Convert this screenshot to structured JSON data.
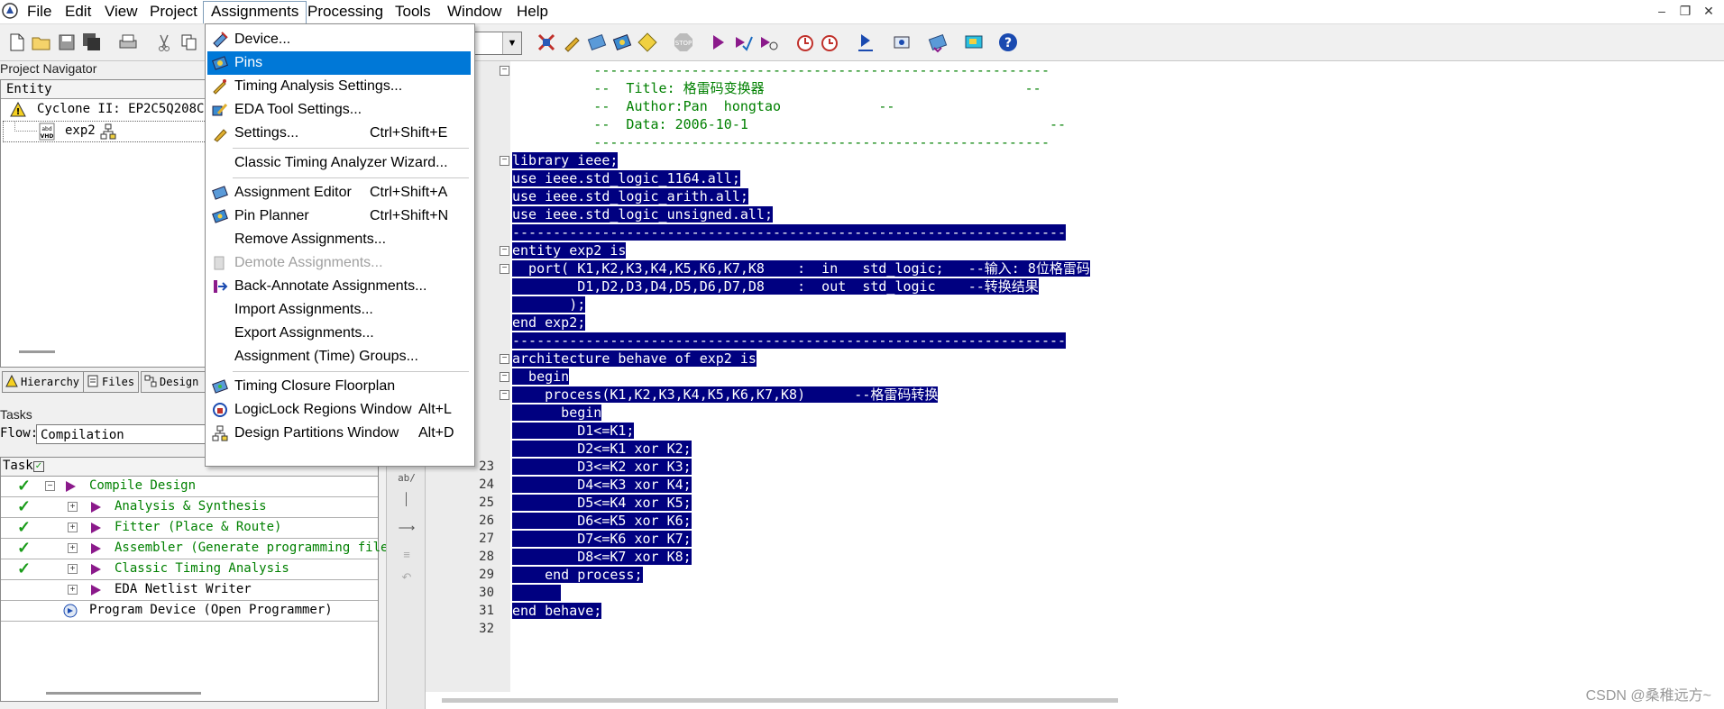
{
  "menubar": {
    "items": [
      "File",
      "Edit",
      "View",
      "Project",
      "Assignments",
      "Processing",
      "Tools",
      "Window",
      "Help"
    ]
  },
  "dropdown": {
    "items": [
      {
        "label": "Device...",
        "shortcut": "",
        "icon": "device-icon"
      },
      {
        "label": "Pins",
        "shortcut": "",
        "icon": "pins-icon"
      },
      {
        "label": "Timing Analysis Settings...",
        "shortcut": "",
        "icon": "timing-settings-icon"
      },
      {
        "label": "EDA Tool Settings...",
        "shortcut": "",
        "icon": "eda-tool-icon"
      },
      {
        "label": "Settings...",
        "shortcut": "Ctrl+Shift+E",
        "icon": "settings-icon"
      },
      {
        "label": "Classic Timing Analyzer Wizard...",
        "shortcut": "",
        "icon": ""
      },
      {
        "label": "Assignment Editor",
        "shortcut": "Ctrl+Shift+A",
        "icon": "assignment-editor-icon"
      },
      {
        "label": "Pin Planner",
        "shortcut": "Ctrl+Shift+N",
        "icon": "pin-planner-icon"
      },
      {
        "label": "Remove Assignments...",
        "shortcut": "",
        "icon": ""
      },
      {
        "label": "Demote Assignments...",
        "shortcut": "",
        "icon": "demote-icon"
      },
      {
        "label": "Back-Annotate Assignments...",
        "shortcut": "",
        "icon": "back-annotate-icon"
      },
      {
        "label": "Import Assignments...",
        "shortcut": "",
        "icon": ""
      },
      {
        "label": "Export Assignments...",
        "shortcut": "",
        "icon": ""
      },
      {
        "label": "Assignment (Time) Groups...",
        "shortcut": "",
        "icon": ""
      },
      {
        "label": "Timing Closure Floorplan",
        "shortcut": "",
        "icon": "floorplan-icon"
      },
      {
        "label": "LogicLock Regions Window",
        "shortcut": "Alt+L",
        "icon": "logiclock-icon"
      },
      {
        "label": "Design Partitions Window",
        "shortcut": "Alt+D",
        "icon": "partitions-icon"
      }
    ]
  },
  "navigator": {
    "title": "Project Navigator",
    "entity_header": "Entity",
    "device": "Cyclone II: EP2C5Q208C8",
    "file": "exp2",
    "tabs": [
      "Hierarchy",
      "Files",
      "Design U"
    ]
  },
  "tasks": {
    "title": "Tasks",
    "flow_label": "Flow:",
    "flow_value": "Compilation",
    "header": "Task",
    "rows": [
      {
        "label": "Compile Design",
        "done": true,
        "green": true
      },
      {
        "label": "Analysis & Synthesis",
        "done": true,
        "green": true
      },
      {
        "label": "Fitter (Place & Route)",
        "done": true,
        "green": true
      },
      {
        "label": "Assembler (Generate programming files)",
        "done": true,
        "green": true
      },
      {
        "label": "Classic Timing Analysis",
        "done": true,
        "green": true
      },
      {
        "label": "EDA Netlist Writer",
        "done": false,
        "green": false
      },
      {
        "label": "Program Device (Open Programmer)",
        "done": false,
        "green": false
      }
    ]
  },
  "editor": {
    "visible_line_numbers": [
      "23",
      "24",
      "25",
      "26",
      "27",
      "28",
      "29",
      "30",
      "31",
      "32"
    ],
    "lines": [
      {
        "text": "          --------------------------------------------------------",
        "sel": false,
        "cmt": true
      },
      {
        "text": "          --  Title: 格雷码变换器                                --",
        "sel": false,
        "cmt": true
      },
      {
        "text": "          --  Author:Pan  hongtao            --",
        "sel": false,
        "cmt": true
      },
      {
        "text": "          --  Data: 2006-10-1                                     --",
        "sel": false,
        "cmt": true
      },
      {
        "text": "          --------------------------------------------------------",
        "sel": false,
        "cmt": true
      },
      {
        "text": "library ieee;",
        "sel": true
      },
      {
        "text": "use ieee.std_logic_1164.all;",
        "sel": true
      },
      {
        "text": "use ieee.std_logic_arith.all;",
        "sel": true
      },
      {
        "text": "use ieee.std_logic_unsigned.all;",
        "sel": true
      },
      {
        "text": "--------------------------------------------------------------------",
        "sel": true
      },
      {
        "text": "entity exp2 is",
        "sel": true
      },
      {
        "text": "  port( K1,K2,K3,K4,K5,K6,K7,K8    :  in   std_logic;   --输入: 8位格雷码",
        "sel": true
      },
      {
        "text": "        D1,D2,D3,D4,D5,D6,D7,D8    :  out  std_logic    --转换结果",
        "sel": true
      },
      {
        "text": "       );",
        "sel": true
      },
      {
        "text": "end exp2;",
        "sel": true
      },
      {
        "text": "--------------------------------------------------------------------",
        "sel": true
      },
      {
        "text": "architecture behave of exp2 is",
        "sel": true
      },
      {
        "text": "  begin",
        "sel": true
      },
      {
        "text": "    process(K1,K2,K3,K4,K5,K6,K7,K8)      --格雷码转换",
        "sel": true
      },
      {
        "text": "      begin",
        "sel": true
      },
      {
        "text": "        D1<=K1;",
        "sel": true
      },
      {
        "text": "        D2<=K1 xor K2;",
        "sel": true
      },
      {
        "text": "        D3<=K2 xor K3;",
        "sel": true
      },
      {
        "text": "        D4<=K3 xor K4;",
        "sel": true
      },
      {
        "text": "        D5<=K4 xor K5;",
        "sel": true
      },
      {
        "text": "        D6<=K5 xor K6;",
        "sel": true
      },
      {
        "text": "        D7<=K6 xor K7;",
        "sel": true
      },
      {
        "text": "        D8<=K7 xor K8;",
        "sel": true
      },
      {
        "text": "    end process;",
        "sel": true
      },
      {
        "text": "      ",
        "sel": true
      },
      {
        "text": "end behave;",
        "sel": true
      },
      {
        "text": "",
        "sel": false
      }
    ]
  },
  "side_strip": {
    "ab_label": "ab/"
  },
  "watermark": "CSDN @桑稚远方~",
  "colors": {
    "selection": "#000080",
    "menu_highlight": "#0078d7",
    "comment": "#008000",
    "task_green": "#008000"
  }
}
